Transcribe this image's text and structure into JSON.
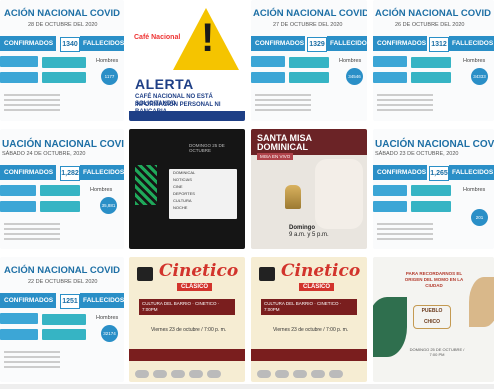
{
  "grid": {
    "covid1": {
      "title": "ACIÓN NACIONAL COVID",
      "date": "28 DE OCTUBRE DEL 2020",
      "confirmed_label": "CONFIRMADOS",
      "confirmed_count": "1340",
      "deaths_label": "FALLECIDOS",
      "gender": "Hombres",
      "circle": "1177"
    },
    "cafe": {
      "logo": "Café Nacional",
      "alert": "ALERTA",
      "message_1": "CAFÉ NACIONAL NO ESTÁ SOLICITANDO",
      "message_2": "INFORMACIÓN PERSONAL NI BANCARIA"
    },
    "covid2": {
      "title": "ACIÓN NACIONAL COVID",
      "date": "27 DE OCTUBRE DEL 2020",
      "confirmed_label": "CONFIRMADOS",
      "confirmed_count": "1329",
      "deaths_label": "FALLECIDOS",
      "gender": "Hombres",
      "circle": "34546"
    },
    "covid3": {
      "title": "ACIÓN NACIONAL COVID",
      "date": "26 DE OCTUBRE DEL 2020",
      "confirmed_label": "CONFIRMADOS",
      "confirmed_count": "1312",
      "deaths_label": "FALLECIDOS",
      "gender": "Hombres",
      "circle": "34333"
    },
    "covid4": {
      "title": "UACIÓN NACIONAL COVID",
      "date": "SÁBADO 24 DE OCTUBRE, 2020",
      "confirmed_label": "CONFIRMADOS",
      "confirmed_count": "1,282",
      "deaths_label": "FALLECIDOS",
      "gender": "Hombres",
      "circle": "35,881"
    },
    "program": {
      "date_title": "DOMINGO 25 DE OCTUBRE",
      "items": [
        "DOMINICAL",
        "NOTICIAS",
        "CINE",
        "DEPORTES",
        "CULTURA",
        "NOCHE"
      ]
    },
    "misa": {
      "title_1": "SANTA MISA",
      "title_2": "DOMINICAL",
      "tag": "MISA EN VIVO",
      "day": "Domingo",
      "time": "9 a.m. y 5 p.m."
    },
    "covid5": {
      "title": "UACIÓN NACIONAL COVID",
      "date": "SÁBADO 23 DE OCTUBRE, 2020",
      "confirmed_label": "CONFIRMADOS",
      "confirmed_count": "1,265",
      "deaths_label": "FALLECIDOS",
      "gender": "Hombres",
      "circle": "201"
    },
    "covid6": {
      "title": "ACIÓN NACIONAL COVID",
      "date": "22 DE OCTUBRE DEL 2020",
      "confirmed_label": "CONFIRMADOS",
      "confirmed_count": "1251",
      "deaths_label": "FALLECIDOS",
      "gender": "Hombres",
      "circle": "32174"
    },
    "cine1": {
      "title": "Cinetico",
      "subtitle": "CLÁSICO",
      "info": "CULTURA DEL BARRIO · CINETICO · 7:00PM",
      "date": "Viernes 23 de octubre / 7:00 p. m."
    },
    "cine2": {
      "title": "Cinetico",
      "subtitle": "CLÁSICO",
      "info": "CULTURA DEL BARRIO · CINETICO · 7:00PM",
      "date": "Viernes 23 de octubre / 7:00 p. m."
    },
    "pueblo": {
      "text": "PARA RECORDARNOS EL ORIGEN DEL MOMO EN LA CIUDAD",
      "badge_1": "PUEBLO",
      "badge_2": "CHICO",
      "footer": "DOMINGO 25 DE OCTUBRE / 7:00 PM"
    }
  }
}
